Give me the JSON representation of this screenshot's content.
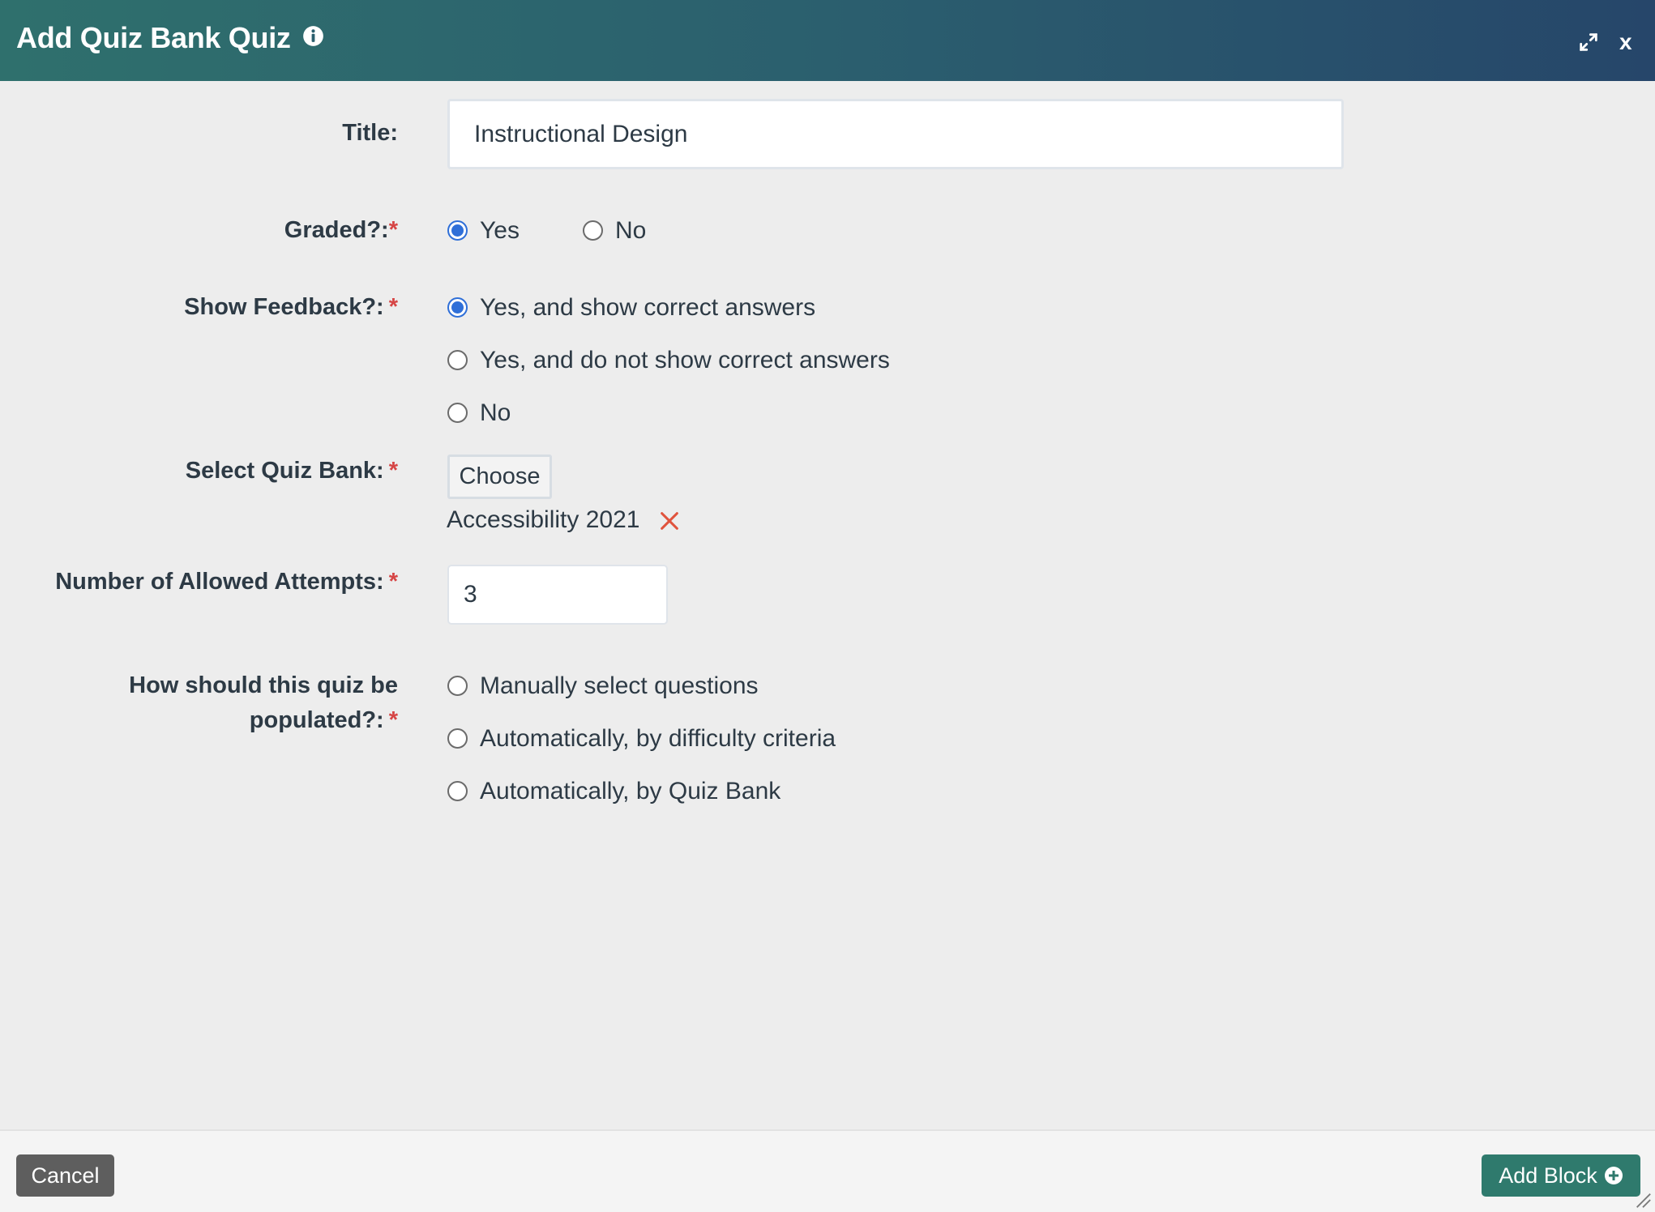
{
  "dialog": {
    "title": "Add Quiz Bank Quiz",
    "close_label": "x",
    "colors": {
      "header_start": "#2f706d",
      "header_end": "#26466a",
      "accent": "#2f6fd8",
      "required": "#d64545",
      "primary_button": "#2f7a6d"
    }
  },
  "form": {
    "title_label": "Title:",
    "title_value": "Instructional Design",
    "graded_label": "Graded?:",
    "graded_options": [
      {
        "label": "Yes",
        "checked": true
      },
      {
        "label": "No",
        "checked": false
      }
    ],
    "feedback_label": "Show Feedback?:",
    "feedback_options": [
      {
        "label": "Yes, and show correct answers",
        "checked": true
      },
      {
        "label": "Yes, and do not show correct answers",
        "checked": false
      },
      {
        "label": "No",
        "checked": false
      }
    ],
    "quiz_bank_label": "Select Quiz Bank:",
    "choose_label": "Choose",
    "selected_bank": "Accessibility 2021",
    "attempts_label": "Number of Allowed Attempts:",
    "attempts_value": "3",
    "populate_label_line1": "How should this quiz be",
    "populate_label_line2": "populated?:",
    "populate_options": [
      {
        "label": "Manually select questions",
        "checked": false
      },
      {
        "label": "Automatically, by difficulty criteria",
        "checked": false
      },
      {
        "label": "Automatically, by Quiz Bank",
        "checked": false
      }
    ],
    "required_mark": "*"
  },
  "footer": {
    "cancel_label": "Cancel",
    "add_label": "Add Block"
  },
  "icons": [
    "info-icon",
    "expand-icon",
    "remove-icon",
    "plus-circle-icon",
    "resize-handle-icon"
  ]
}
